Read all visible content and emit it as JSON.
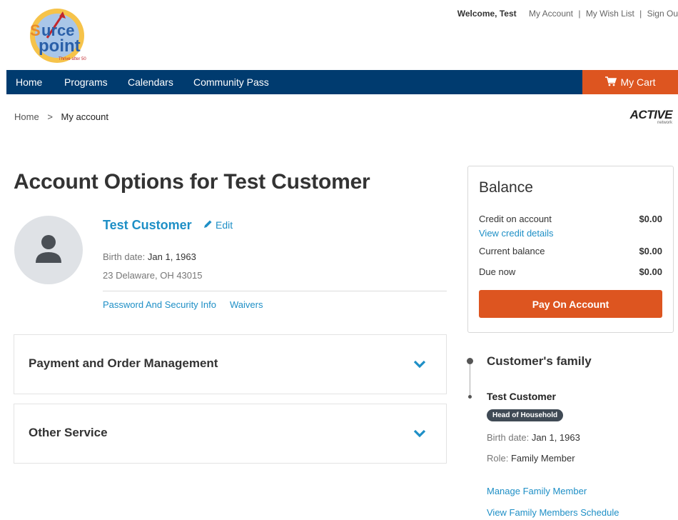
{
  "header": {
    "logo": {
      "text_top": "Source",
      "text_bottom": "point",
      "tagline": "Thrive after 50"
    },
    "welcome": "Welcome, Test",
    "links": [
      "My Account",
      "My Wish List",
      "Sign Ou"
    ]
  },
  "nav": {
    "items": [
      "Home",
      "Programs",
      "Calendars",
      "Community Pass"
    ],
    "cart_label": "My Cart",
    "bar_color": "#003b6f",
    "cart_color": "#dd5520"
  },
  "breadcrumb": {
    "home": "Home",
    "separator": ">",
    "current": "My account"
  },
  "active_logo": {
    "word": "ACTIVE",
    "sub": "network"
  },
  "page_title": "Account Options for Test Customer",
  "profile": {
    "name": "Test Customer",
    "edit_label": "Edit",
    "birth_label": "Birth date:",
    "birth_value": "Jan 1, 1963",
    "address": "23 Delaware, OH 43015",
    "links": [
      "Password And Security Info",
      "Waivers"
    ]
  },
  "accordions": [
    {
      "label": "Payment and Order Management"
    },
    {
      "label": "Other Service"
    }
  ],
  "balance": {
    "title": "Balance",
    "credit_label": "Credit on account",
    "credit_value": "$0.00",
    "credit_link": "View credit details",
    "current_label": "Current balance",
    "current_value": "$0.00",
    "due_label": "Due now",
    "due_value": "$0.00",
    "pay_button": "Pay On Account"
  },
  "family": {
    "title": "Customer's family",
    "member_name": "Test Customer",
    "badge": "Head of Household",
    "birth_label": "Birth date:",
    "birth_value": "Jan 1, 1963",
    "role_label": "Role:",
    "role_value": "Family Member",
    "links": [
      "Manage Family Member",
      "View Family Members Schedule"
    ]
  },
  "colors": {
    "link": "#1e8fc6",
    "accent": "#dd5520",
    "badge": "#404a55"
  }
}
